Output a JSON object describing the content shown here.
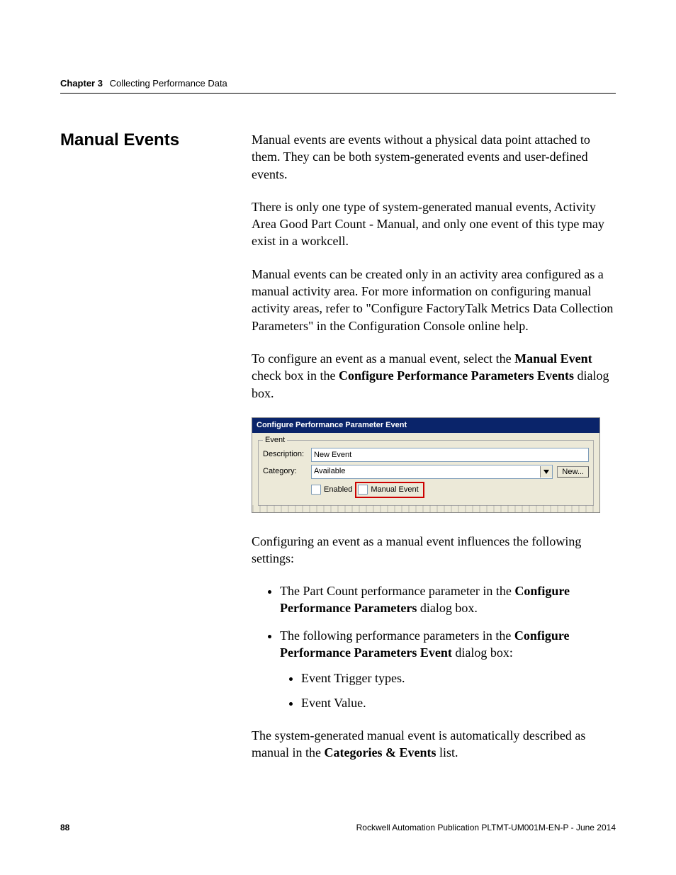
{
  "header": {
    "chapter_label": "Chapter 3",
    "chapter_title": "Collecting Performance Data"
  },
  "side_heading": "Manual Events",
  "paragraphs": {
    "p1": "Manual events are events without a physical data point attached to them. They can be both system-generated events and user-defined events.",
    "p2": "There is only one type of system-generated manual events, Activity Area Good Part Count - Manual, and only one event of this type may exist in a workcell.",
    "p3": "Manual events can be created only in an activity area configured as a manual activity area. For more information on configuring manual activity areas, refer to \"Configure FactoryTalk Metrics Data Collection Parameters\" in the Configuration Console online help.",
    "p4_pre": "To configure an event as a manual event, select the ",
    "p4_bold1": "Manual Event",
    "p4_mid": " check box in the ",
    "p4_bold2": "Configure Performance Parameters Events",
    "p4_post": " dialog box.",
    "p5": "Configuring an event as a manual event influences the following settings:",
    "b1_pre": "The Part Count performance parameter in the ",
    "b1_bold": "Configure Performance Parameters",
    "b1_post": " dialog box.",
    "b2_pre": "The following performance parameters in the ",
    "b2_bold": "Configure Performance Parameters Event",
    "b2_post": " dialog box:",
    "b2a": "Event Trigger types.",
    "b2b": "Event Value.",
    "p6_pre": "The system-generated manual event is automatically described as manual in the ",
    "p6_bold": "Categories & Events",
    "p6_post": " list."
  },
  "dialog": {
    "title": "Configure Performance Parameter Event",
    "legend": "Event",
    "description_label": "Description:",
    "description_value": "New Event",
    "category_label": "Category:",
    "category_value": "Available",
    "new_button": "New...",
    "enabled_label": "Enabled",
    "manual_event_label": "Manual Event"
  },
  "footer": {
    "page_number": "88",
    "pub_line": "Rockwell Automation Publication PLTMT-UM001M-EN-P - June 2014"
  }
}
